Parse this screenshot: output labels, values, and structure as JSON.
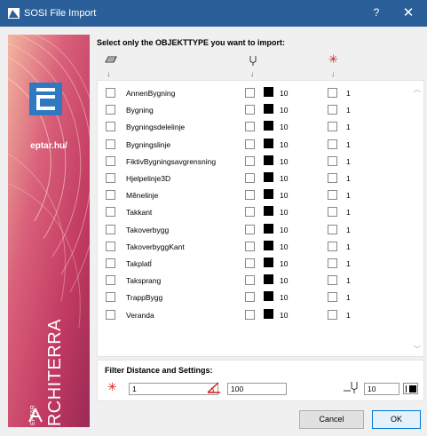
{
  "window": {
    "title": "SOSI File Import",
    "help_label": "?",
    "close_label": "✕"
  },
  "banner": {
    "site": "eptar.hu/",
    "brand": "ARCHITERRA",
    "brand_prefix": "EPTAR"
  },
  "heading": "Select only the OBJEKTTYPE you want to import:",
  "column_arrow": "↓",
  "objects": [
    {
      "name": "AnnenBygning",
      "pen": "10",
      "value": "1"
    },
    {
      "name": "Bygning",
      "pen": "10",
      "value": "1"
    },
    {
      "name": "Bygningsdelelinje",
      "pen": "10",
      "value": "1"
    },
    {
      "name": "Bygningslinje",
      "pen": "10",
      "value": "1"
    },
    {
      "name": "FiktivBygningsavgrensning",
      "pen": "10",
      "value": "1"
    },
    {
      "name": "Hjelpelinje3D",
      "pen": "10",
      "value": "1"
    },
    {
      "name": "Mĕnelinje",
      "pen": "10",
      "value": "1"
    },
    {
      "name": "Takkant",
      "pen": "10",
      "value": "1"
    },
    {
      "name": "Takoverbygg",
      "pen": "10",
      "value": "1"
    },
    {
      "name": "TakoverbyggKant",
      "pen": "10",
      "value": "1"
    },
    {
      "name": "Takplatĺ",
      "pen": "10",
      "value": "1"
    },
    {
      "name": "Taksprang",
      "pen": "10",
      "value": "1"
    },
    {
      "name": "TrappBygg",
      "pen": "10",
      "value": "1"
    },
    {
      "name": "Veranda",
      "pen": "10",
      "value": "1"
    }
  ],
  "filter": {
    "title": "Filter Distance and Settings:",
    "distance_value": "1",
    "angle_value": "100",
    "pen_value": "10"
  },
  "buttons": {
    "cancel": "Cancel",
    "ok": "OK"
  },
  "colors": {
    "titlebar": "#2b5f9a",
    "accent_red": "#d21919",
    "banner": "#c84a66"
  }
}
